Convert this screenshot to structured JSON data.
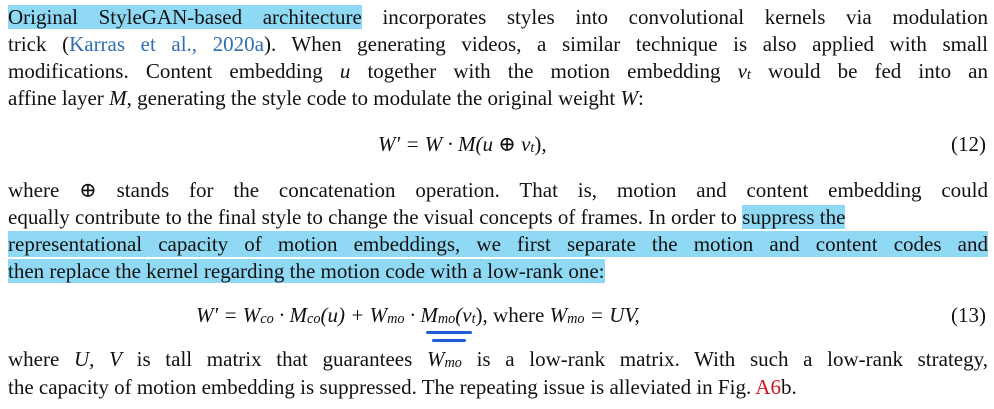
{
  "paragraph1": {
    "line1_highlight": "Original StyleGAN-based architecture",
    "line1_rest": " incorporates styles into convolutional kernels via modulation",
    "line2_pre": "trick (",
    "line2_cite": "Karras et al., 2020a",
    "line2_post": "). When generating videos, a similar technique is also applied with small",
    "line3_pre": "modifications. Content embedding ",
    "line3_var_u": "u",
    "line3_mid": " together with the motion embedding ",
    "line3_var_v": "v",
    "line3_sub_t": "t",
    "line3_post": " would be fed into an",
    "line4_pre": "affine layer ",
    "line4_var_M": "M",
    "line4_mid": ", generating the style code to modulate the original weight ",
    "line4_var_W": "W",
    "line4_post": ":"
  },
  "equation12": {
    "lhs": "W′",
    "rhs": "= W · M(u ⊕ v",
    "sub_t": "t",
    "close": "),",
    "number": "(12)"
  },
  "paragraph2": {
    "line1": "where ⊕ stands for the concatenation operation.  That is, motion and content embedding could",
    "line2": "equally contribute to the final style to change the visual concepts of frames. In order to",
    "line2_highlight": "suppress the",
    "line3_highlight": "representational capacity of motion embeddings, we first separate the motion and content codes and",
    "line4_highlight": "then replace the kernel regarding the motion code with a low-rank one:"
  },
  "equation13": {
    "part1": "W′ = W",
    "sub_co": "co",
    "part2": " · M",
    "part3": "(u) + ",
    "wmo": "W",
    "sub_mo": "mo",
    "part4": " · M",
    "part5": "(v",
    "sub_t": "t",
    "part6": "),  ",
    "where": "where ",
    "part7": "W",
    "part8": " = UV,",
    "number": "(13)"
  },
  "paragraph3": {
    "line1_pre": "where ",
    "line1_vars": "U, V",
    "line1_mid": " is tall matrix that guarantees ",
    "line1_W": "W",
    "line1_sub": "mo",
    "line1_post": " is a low-rank matrix. With such a low-rank strategy,",
    "line2_pre": "the capacity of motion embedding is suppressed. The repeating issue is alleviated in Fig. ",
    "line2_ref": "A6",
    "line2_post": "b."
  },
  "colors": {
    "highlight": "#8fd9f5",
    "citation_link": "#2f6fb0",
    "figure_ref": "#d1141a",
    "pen_underline": "#1f5fd6"
  }
}
